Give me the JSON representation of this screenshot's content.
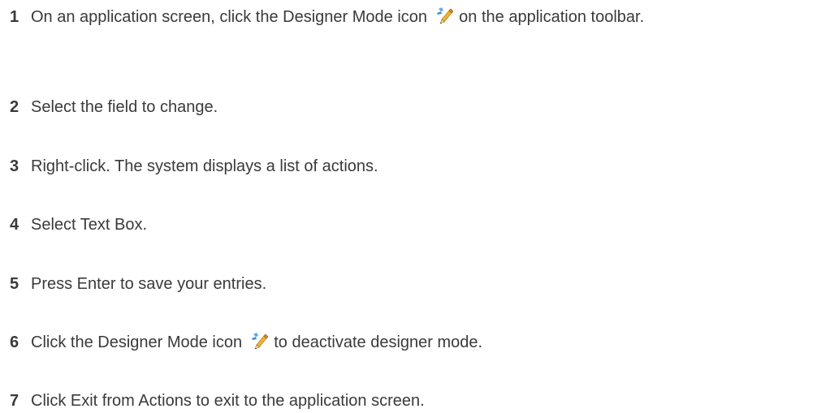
{
  "steps": [
    {
      "number": "1",
      "before": "On an application screen, click the Designer Mode icon",
      "icon": "designer-mode-icon",
      "after": "on the application toolbar."
    },
    {
      "number": "2",
      "text": "Select the field to change."
    },
    {
      "number": "3",
      "text": "Right-click. The system displays a list of actions."
    },
    {
      "number": "4",
      "text": "Select Text Box."
    },
    {
      "number": "5",
      "text": "Press Enter to save your entries."
    },
    {
      "number": "6",
      "before": "Click the Designer Mode icon",
      "icon": "designer-mode-icon",
      "after": "to deactivate designer mode."
    },
    {
      "number": "7",
      "text": "Click Exit from Actions to exit to the application screen."
    }
  ]
}
